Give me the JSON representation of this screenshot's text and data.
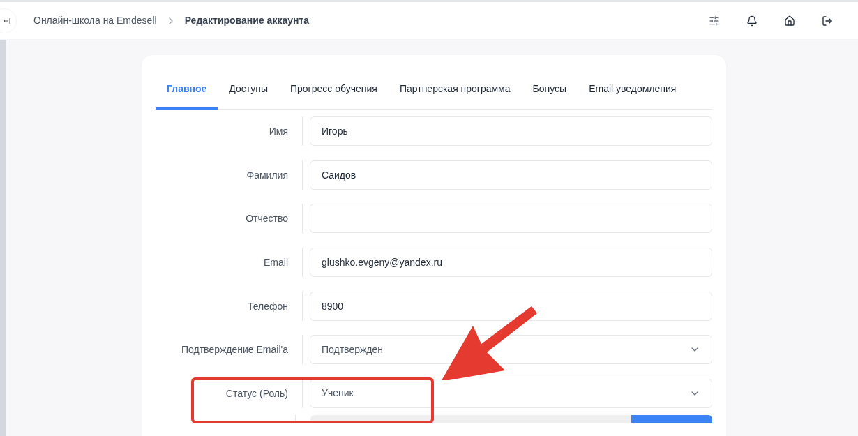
{
  "breadcrumbs": [
    {
      "label": "Онлайн-школа на Emdesell",
      "current": false
    },
    {
      "label": "Редактирование аккаунта",
      "current": true
    }
  ],
  "tabs": [
    {
      "label": "Главное",
      "selected": true
    },
    {
      "label": "Доступы",
      "selected": false
    },
    {
      "label": "Прогресс обучения",
      "selected": false
    },
    {
      "label": "Партнерская программа",
      "selected": false
    },
    {
      "label": "Бонусы",
      "selected": false
    },
    {
      "label": "Email уведомления",
      "selected": false
    }
  ],
  "fields": [
    {
      "kind": "text",
      "label": "Имя",
      "value": "Игорь"
    },
    {
      "kind": "text",
      "label": "Фамилия",
      "value": "Саидов"
    },
    {
      "kind": "text",
      "label": "Отчество"
    },
    {
      "kind": "text",
      "label": "Email",
      "value": "glushko.evgeny@yandex.ru"
    },
    {
      "kind": "text",
      "label": "Телефон",
      "value": "8900"
    },
    {
      "kind": "select",
      "label": "Подтверждение Email'a",
      "value": "Подтвержден"
    },
    {
      "kind": "select",
      "label": "Статус (Роль)",
      "value": "Ученик"
    },
    {
      "kind": "upload"
    }
  ]
}
